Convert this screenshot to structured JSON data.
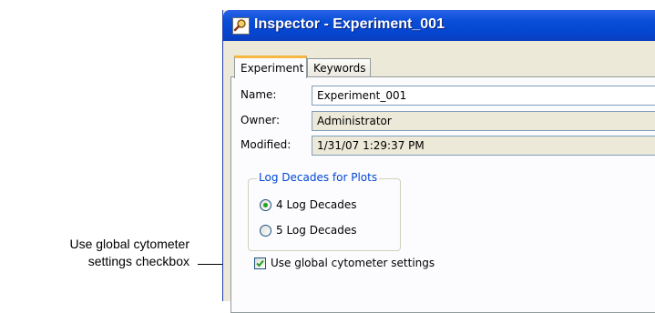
{
  "callout": {
    "line1": "Use global cytometer",
    "line2": "settings checkbox"
  },
  "window": {
    "title": "Inspector - Experiment_001",
    "icon": "magnifier-icon"
  },
  "tabs": [
    {
      "label": "Experiment",
      "active": true
    },
    {
      "label": "Keywords",
      "active": false
    }
  ],
  "form": {
    "name": {
      "label": "Name:",
      "value": "Experiment_001"
    },
    "owner": {
      "label": "Owner:",
      "value": "Administrator"
    },
    "modified": {
      "label": "Modified:",
      "value": "1/31/07 1:29:37 PM"
    }
  },
  "log_decades": {
    "title": "Log Decades for Plots",
    "options": [
      {
        "label": "4 Log Decades",
        "selected": true
      },
      {
        "label": "5 Log Decades",
        "selected": false
      }
    ]
  },
  "global_settings": {
    "label": "Use global cytometer settings",
    "checked": true
  },
  "colors": {
    "title_bar": "#0a4ed8",
    "group_title": "#0046d5",
    "checkmark": "#21a121",
    "tab_highlight": "#f7b740"
  }
}
